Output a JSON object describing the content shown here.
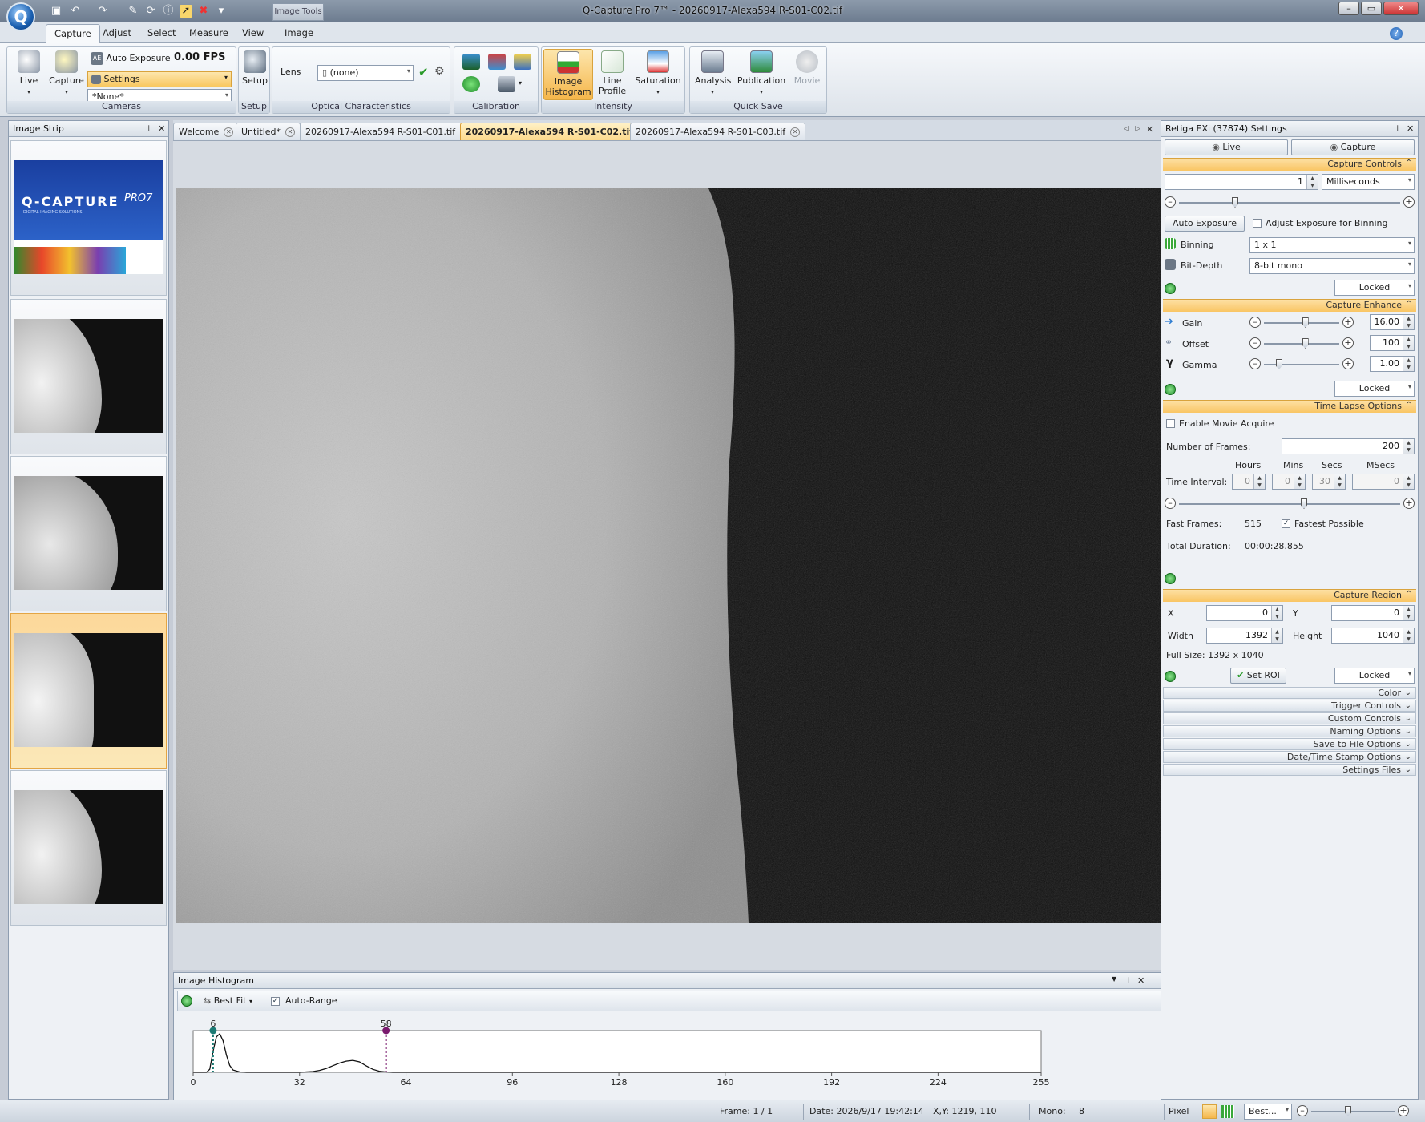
{
  "window": {
    "title": "Q-Capture Pro 7™ - 20260917-Alexa594 R-S01-C02.tif",
    "contextual_tab": "Image Tools"
  },
  "ribbon": {
    "tabs": [
      "Capture",
      "Adjust",
      "Select",
      "Measure",
      "View",
      "Image"
    ],
    "active_tab": "Capture",
    "cameras": {
      "live": "Live",
      "capture": "Capture",
      "auto_exposure": "Auto Exposure",
      "fps": "0.00 FPS",
      "settings": "Settings",
      "preset": "*None*",
      "group": "Cameras"
    },
    "setup": {
      "setup": "Setup",
      "group": "Setup"
    },
    "optical": {
      "lens_label": "Lens",
      "lens_value": "(none)",
      "group": "Optical Characteristics"
    },
    "calibration": {
      "group": "Calibration"
    },
    "intensity": {
      "histogram_l1": "Image",
      "histogram_l2": "Histogram",
      "line_l1": "Line",
      "line_l2": "Profile",
      "saturation": "Saturation",
      "group": "Intensity"
    },
    "quicksave": {
      "analysis": "Analysis",
      "publication": "Publication",
      "movie": "Movie",
      "group": "Quick Save"
    }
  },
  "strip": {
    "title": "Image Strip",
    "logo_text": "Q-CAPTURE",
    "logo_suffix": "PRO7",
    "logo_sub": "DIGITAL IMAGING SOLUTIONS"
  },
  "doc_tabs": [
    "Welcome",
    "Untitled*",
    "20260917-Alexa594 R-S01-C01.tif",
    "20260917-Alexa594 R-S01-C02.tif",
    "20260917-Alexa594 R-S01-C03.tif"
  ],
  "histogram": {
    "title": "Image Histogram",
    "fit": "Best Fit",
    "auto_range": "Auto-Range",
    "chart_data": {
      "type": "area",
      "x_ticks": [
        0,
        32,
        64,
        96,
        128,
        160,
        192,
        224,
        255
      ],
      "xlim": [
        0,
        255
      ],
      "markers": [
        {
          "label": "6",
          "value": 6,
          "color": "#1c7a74"
        },
        {
          "label": "58",
          "value": 58,
          "color": "#7a1a6e"
        }
      ],
      "x": [
        0,
        2,
        4,
        5,
        6,
        7,
        8,
        9,
        10,
        11,
        12,
        14,
        16,
        18,
        20,
        24,
        28,
        32,
        36,
        38,
        40,
        42,
        44,
        46,
        48,
        50,
        52,
        54,
        56,
        58,
        60,
        64,
        255
      ],
      "y": [
        0,
        0,
        0,
        0.08,
        0.55,
        0.92,
        1.0,
        0.82,
        0.45,
        0.18,
        0.06,
        0.01,
        0,
        0,
        0,
        0,
        0,
        0,
        0.02,
        0.05,
        0.1,
        0.17,
        0.24,
        0.29,
        0.31,
        0.27,
        0.17,
        0.08,
        0.03,
        0.01,
        0,
        0,
        0
      ]
    }
  },
  "settings": {
    "title": "Retiga EXi (37874) Settings",
    "live": "Live",
    "capture": "Capture",
    "capture_controls": "Capture Controls",
    "exposure_value": "1",
    "exposure_unit": "Milliseconds",
    "auto_exposure": "Auto Exposure",
    "adjust_binning": "Adjust Exposure for Binning",
    "binning_label": "Binning",
    "binning_value": "1 x 1",
    "bitdepth_label": "Bit-Depth",
    "bitdepth_value": "8-bit mono",
    "locked": "Locked",
    "capture_enhance": "Capture Enhance",
    "gain_label": "Gain",
    "gain_value": "16.00",
    "gain_level": 0.55,
    "offset_label": "Offset",
    "offset_value": "100",
    "offset_level": 0.55,
    "gamma_label": "Gamma",
    "gamma_value": "1.00",
    "gamma_level": 0.2,
    "time_lapse": "Time Lapse Options",
    "enable_movie": "Enable Movie Acquire",
    "frames_label": "Number of  Frames:",
    "frames_value": "200",
    "hours": "Hours",
    "mins": "Mins",
    "secs": "Secs",
    "msecs": "MSecs",
    "interval_label": "Time Interval:",
    "h_val": "0",
    "m_val": "0",
    "s_val": "30",
    "ms_val": "0",
    "fast_frames_label": "Fast Frames:",
    "fast_frames_value": "515",
    "fastest": "Fastest Possible",
    "total_label": "Total Duration:",
    "total_value": "00:00:28.855",
    "capture_region": "Capture Region",
    "x_label": "X",
    "x_val": "0",
    "y_label": "Y",
    "y_val": "0",
    "w_label": "Width",
    "w_val": "1392",
    "h_label": "Height",
    "h_val2": "1040",
    "full_size": "Full Size: 1392 x 1040",
    "set_roi": "Set ROI",
    "collapsed": [
      "Color",
      "Trigger Controls",
      "Custom Controls",
      "Naming Options",
      "Save to File Options",
      "Date/Time Stamp Options",
      "Settings Files"
    ]
  },
  "status": {
    "frame": "Frame: 1 / 1",
    "date": "Date: 2026/9/17 19:42:14",
    "xy": "X,Y: 1219,  110",
    "mono_label": "Mono:",
    "mono_value": "8",
    "pixel": "Pixel",
    "zoom": "Best..."
  }
}
